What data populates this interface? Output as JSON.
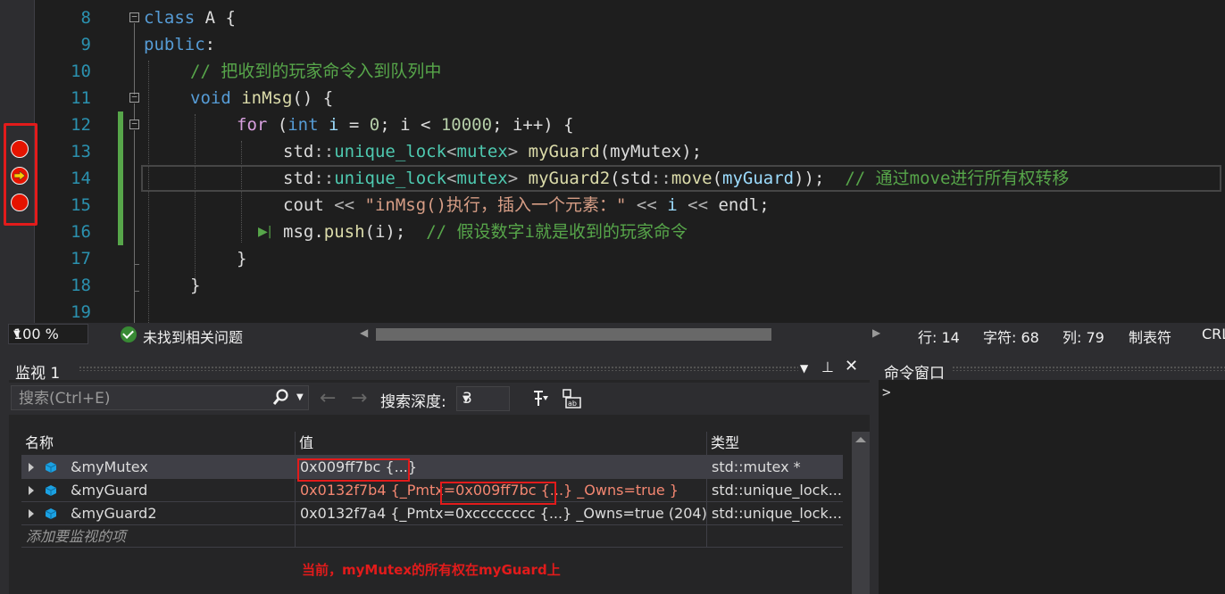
{
  "editor": {
    "line_numbers": [
      "8",
      "9",
      "10",
      "11",
      "12",
      "13",
      "14",
      "15",
      "16",
      "17",
      "18",
      "19"
    ],
    "lines": {
      "l8": {
        "kw": "class",
        "name": " A {"
      },
      "l9": {
        "kw": "public",
        "rest": ":"
      },
      "l10": {
        "comment": "// 把收到的玩家命令入到队列中"
      },
      "l11": {
        "kw": "void",
        "fn": "inMsg",
        "rest": "() {"
      },
      "l12": {
        "kw_for": "for",
        "p1": " (",
        "kw_int": "int",
        "v": " i",
        "op": " = ",
        "n0": "0",
        "sc": "; i < ",
        "n1": "10000",
        "rest": "; i++) {"
      },
      "l13": {
        "ns": "std",
        "sep": "::",
        "ty": "unique_lock",
        "lt": "<",
        "ty2": "mutex",
        "gt": ">",
        "fn": "myGuard",
        "p": "(",
        "var": "myMutex",
        "end": ");"
      },
      "l14": {
        "ns": "std",
        "sep": "::",
        "ty": "unique_lock",
        "lt": "<",
        "ty2": "mutex",
        "gt": ">",
        "fn": "myGuard2",
        "p": "(",
        "ns2": "std",
        "sep2": "::",
        "fn2": "move",
        "p2": "(",
        "var": "myGuard",
        "end": "));",
        "comment": "// 通过move进行所有权转移"
      },
      "l15": {
        "ident": "cout",
        "op1": " << ",
        "str": "\"inMsg()执行，插入一个元素：\"",
        "op2": " << ",
        "v": "i",
        "op3": " << ",
        "e": "endl",
        "end": ";"
      },
      "l16": {
        "var": "msg",
        "dot": ".",
        "fn": "push",
        "rest": "(i);",
        "comment": "// 假设数字i就是收到的玩家命令"
      },
      "l17": {
        "rest": "}"
      },
      "l18": {
        "rest": "}"
      }
    }
  },
  "status": {
    "zoom": "100 %",
    "issues": "未找到相关问题",
    "line": "行: 14",
    "char": "字符: 68",
    "col": "列: 79",
    "tabs": "制表符",
    "eol": "CRLF"
  },
  "watch": {
    "title": "监视 1",
    "search_placeholder": "搜索(Ctrl+E)",
    "depth_label": "搜索深度:",
    "depth_value": "3",
    "columns": [
      "名称",
      "值",
      "类型"
    ],
    "rows": [
      {
        "name": "&myMutex",
        "value": "0x009ff7bc {...}",
        "type": "std::mutex *"
      },
      {
        "name": "&myGuard",
        "value_pre": "0x0132f7b4 {_Pmtx=",
        "value_hl": "0x009ff7bc {...}",
        "value_post": " _Owns=true }",
        "type": "std::unique_lock..."
      },
      {
        "name": "&myGuard2",
        "value": "0x0132f7a4 {_Pmtx=0xcccccccc {...} _Owns=true (204) }",
        "type": "std::unique_lock..."
      }
    ],
    "add_item": "添加要监视的项",
    "annotation": "当前，myMutex的所有权在myGuard上"
  },
  "command": {
    "title": "命令窗口",
    "prompt": ">"
  },
  "colors": {
    "breakpoint": "#e51400",
    "highlight_box": "#e21b1b",
    "changed_value": "#f48771"
  }
}
